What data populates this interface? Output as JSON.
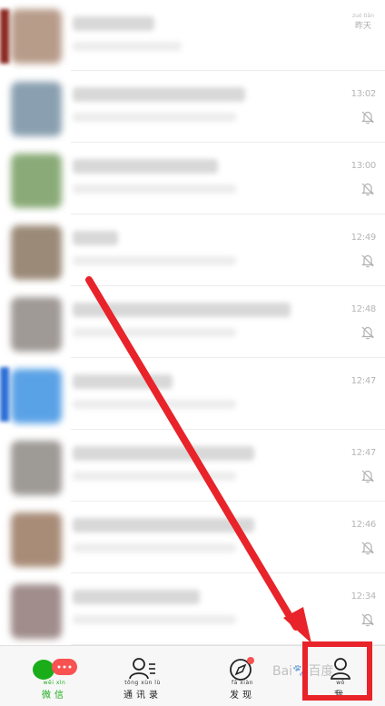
{
  "chats": [
    {
      "time": "",
      "time_pinyin": "zuó tiān",
      "time_hanzi": "昨天",
      "muted": false,
      "avatar_color": "#b89c8a",
      "name_w": 90,
      "prev_w": 120
    },
    {
      "time": "13:02",
      "muted": true,
      "avatar_color": "#8aa0b0",
      "name_w": 190,
      "prev_w": 0
    },
    {
      "time": "13:00",
      "muted": true,
      "avatar_color": "#8aab78",
      "name_w": 160,
      "prev_w": 0
    },
    {
      "time": "12:49",
      "muted": true,
      "avatar_color": "#9b8a78",
      "name_w": 50,
      "prev_w": 0
    },
    {
      "time": "12:48",
      "muted": true,
      "avatar_color": "#a09a96",
      "name_w": 240,
      "prev_w": 0
    },
    {
      "time": "12:47",
      "muted": false,
      "avatar_color": "#5aa2e6",
      "name_w": 110,
      "prev_w": 0
    },
    {
      "time": "12:47",
      "muted": true,
      "avatar_color": "#9e9a96",
      "name_w": 200,
      "prev_w": 0
    },
    {
      "time": "12:46",
      "muted": true,
      "avatar_color": "#a88c78",
      "name_w": 200,
      "prev_w": 0
    },
    {
      "time": "12:34",
      "muted": true,
      "avatar_color": "#a08d8c",
      "name_w": 140,
      "prev_w": 0
    }
  ],
  "tabs": [
    {
      "pinyin": "wēi xìn",
      "label": "微信",
      "active": true,
      "icon": "chat-bubbles-icon"
    },
    {
      "pinyin": "tōng xùn lù",
      "label": "通讯录",
      "active": false,
      "icon": "contacts-icon"
    },
    {
      "pinyin": "fā xiàn",
      "label": "发现",
      "active": false,
      "icon": "compass-icon"
    },
    {
      "pinyin": "wǒ",
      "label": "我",
      "active": false,
      "icon": "person-icon"
    }
  ],
  "badge": {
    "text": "···"
  },
  "watermark": "Bai🐾百度",
  "colors": {
    "accent": "#1aad19",
    "highlight": "#e8232a",
    "badge": "#fa5151"
  }
}
